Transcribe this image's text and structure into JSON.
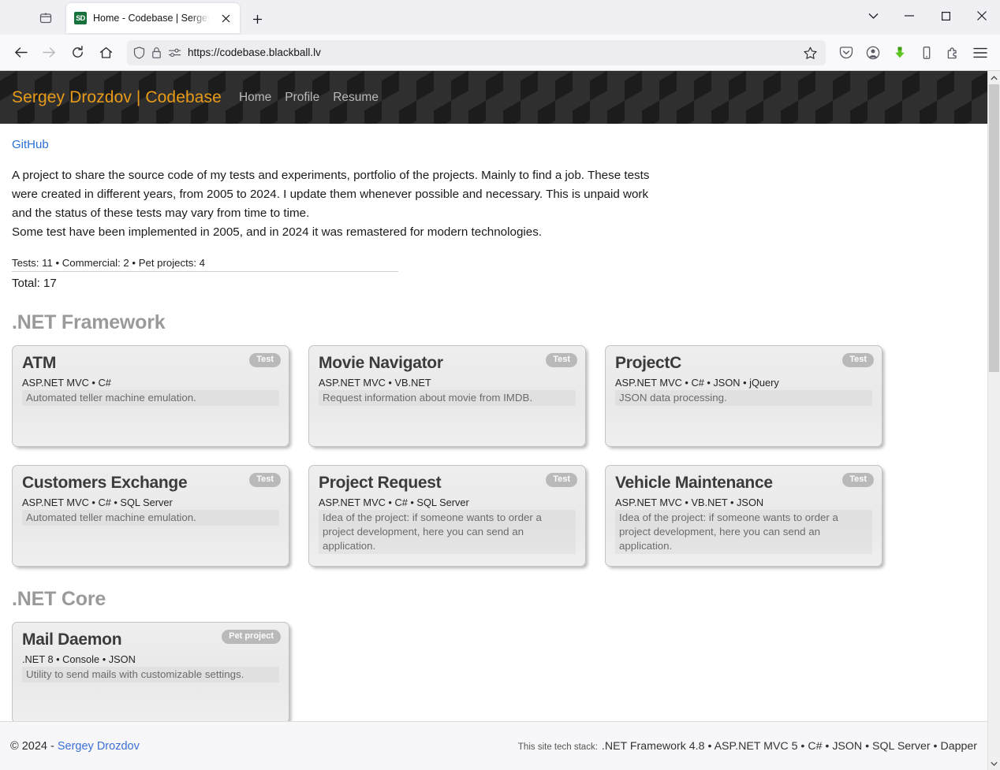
{
  "browser": {
    "tab": {
      "title": "Home - Codebase | Sergey Droz",
      "favicon_text": "SD",
      "favicon_color": "#17713a"
    },
    "new_tab_label": "+",
    "url": "https://codebase.blackball.lv",
    "window_controls": {
      "minimize": "—",
      "maximize": "□",
      "close": "✕",
      "list_all_tabs": "⌄"
    },
    "toolbar_icons": [
      "shield-icon",
      "lock-icon",
      "permissions-icon",
      "bookmark-star-icon",
      "pocket-icon",
      "account-icon",
      "downloads-icon",
      "mobile-icon",
      "extensions-icon",
      "app-menu-icon"
    ],
    "nav_icons": [
      "back-icon",
      "forward-icon",
      "reload-icon",
      "home-icon"
    ]
  },
  "site": {
    "brand": "Sergey Drozdov | Codebase",
    "nav": [
      {
        "label": "Home"
      },
      {
        "label": "Profile"
      },
      {
        "label": "Resume"
      }
    ],
    "brand_color": "#e89b17"
  },
  "page": {
    "github_link": "GitHub",
    "intro_lines": [
      "A project to share the source code of my tests and experiments, portfolio of the projects. Mainly to find a job. These tests",
      "were created in different years, from 2005 to 2024. I update them whenever possible and necessary. This is unpaid work",
      "and the status of these tests may vary from time to time.",
      "Some test have been implemented in 2005, and in 2024 it was remastered for modern technologies."
    ],
    "stats_line": "Tests: 11 • Commercial: 2 • Pet projects: 4",
    "total_line": "Total: 17",
    "counts": {
      "tests": 11,
      "commercial": 2,
      "pet_projects": 4,
      "total": 17
    }
  },
  "sections": [
    {
      "title": ".NET Framework",
      "cards": [
        {
          "title": "ATM",
          "stack": "ASP.NET MVC • C#",
          "description": "Automated teller machine emulation.",
          "badge": "Test"
        },
        {
          "title": "Movie Navigator",
          "stack": "ASP.NET MVC • VB.NET",
          "description": "Request information about movie from IMDB.",
          "badge": "Test"
        },
        {
          "title": "ProjectC",
          "stack": "ASP.NET MVC • C# • JSON • jQuery",
          "description": "JSON data processing.",
          "badge": "Test"
        },
        {
          "title": "Customers Exchange",
          "stack": "ASP.NET MVC • C# • SQL Server",
          "description": "Automated teller machine emulation.",
          "badge": "Test"
        },
        {
          "title": "Project Request",
          "stack": "ASP.NET MVC • C# • SQL Server",
          "description": "Idea of the project: if someone wants to order a project development, here you can send an application.",
          "badge": "Test"
        },
        {
          "title": "Vehicle Maintenance",
          "stack": "ASP.NET MVC • VB.NET • JSON",
          "description": "Idea of the project: if someone wants to order a project development, here you can send an application.",
          "badge": "Test"
        }
      ]
    },
    {
      "title": ".NET Core",
      "cards": [
        {
          "title": "Mail Daemon",
          "stack": ".NET 8 • Console • JSON",
          "description": "Utility to send mails with customizable settings.",
          "badge": "Pet project"
        }
      ]
    }
  ],
  "footer": {
    "copyright_prefix": "© 2024 - ",
    "author": "Sergey Drozdov",
    "techstack_label": "This site tech stack:",
    "techstack": ".NET Framework 4.8 • ASP.NET MVC 5 • C# • JSON • SQL Server • Dapper"
  }
}
